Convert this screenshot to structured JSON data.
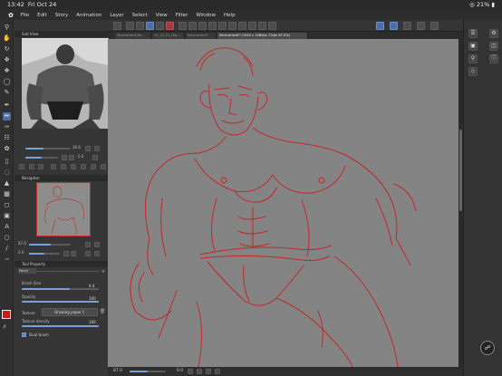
{
  "status_bar": {
    "time": "13:42",
    "date": "Fri Oct 24",
    "battery": "21%"
  },
  "menu": {
    "items": [
      "File",
      "Edit",
      "Story",
      "Animation",
      "Layer",
      "Select",
      "View",
      "Filter",
      "Window",
      "Help"
    ]
  },
  "tabs": [
    {
      "label": "Illustration4(Re...",
      "active": false
    },
    {
      "label": "25_10_01_Dig...",
      "active": false
    },
    {
      "label": "Illustration3*",
      "active": false
    },
    {
      "label": "Illustration6* (1920 x 1080px 72dpi 87.0%)",
      "active": true
    }
  ],
  "panels": {
    "sub_view": {
      "title": "Sub View"
    },
    "subview_controls": {
      "zoom": "36.6",
      "angle": "0.0"
    },
    "subview_nav_row": {
      "rot": "0.0"
    },
    "navigator": {
      "title": "Navigator"
    },
    "navigator_controls": {
      "zoom": "87.0",
      "angle": "0.0"
    },
    "tool_property": {
      "title": "Tool Property",
      "tool_name": "Pencil",
      "brush_size_label": "Brush Size",
      "brush_size_value": "4.4",
      "opacity_label": "Opacity",
      "opacity_value": "100",
      "texture_label": "Texture",
      "texture_value": "Drawing paper C",
      "texture_density_label": "Texture density",
      "texture_density_value": "100",
      "dual_brush_label": "Dual brush",
      "brush_size_fraction": 0.62,
      "opacity_fraction": 1.0,
      "texture_density_fraction": 1.0
    }
  },
  "bottom_bar": {
    "zoom": "87.0",
    "angle": "0.0"
  },
  "colors": {
    "accent": "#4a6ea8",
    "main_color": "#cc1a1a",
    "sketch_line": "#c4262b"
  },
  "icons": {
    "toolbar": [
      "zoom-icon",
      "hand-icon",
      "rotate-icon",
      "move-icon",
      "select-icon",
      "lasso-icon",
      "eyedropper-icon",
      "pen-icon",
      "pencil-icon",
      "brush-icon",
      "airbrush-icon",
      "decoration-icon",
      "eraser-icon",
      "blend-icon",
      "fill-icon",
      "gradient-icon",
      "figure-icon",
      "frame-icon",
      "text-icon",
      "balloon-icon",
      "ruler-icon",
      "correct-line-icon"
    ],
    "right": [
      "layers-icon",
      "material-icon",
      "search-icon",
      "settings-icon",
      "companion-icon"
    ]
  }
}
